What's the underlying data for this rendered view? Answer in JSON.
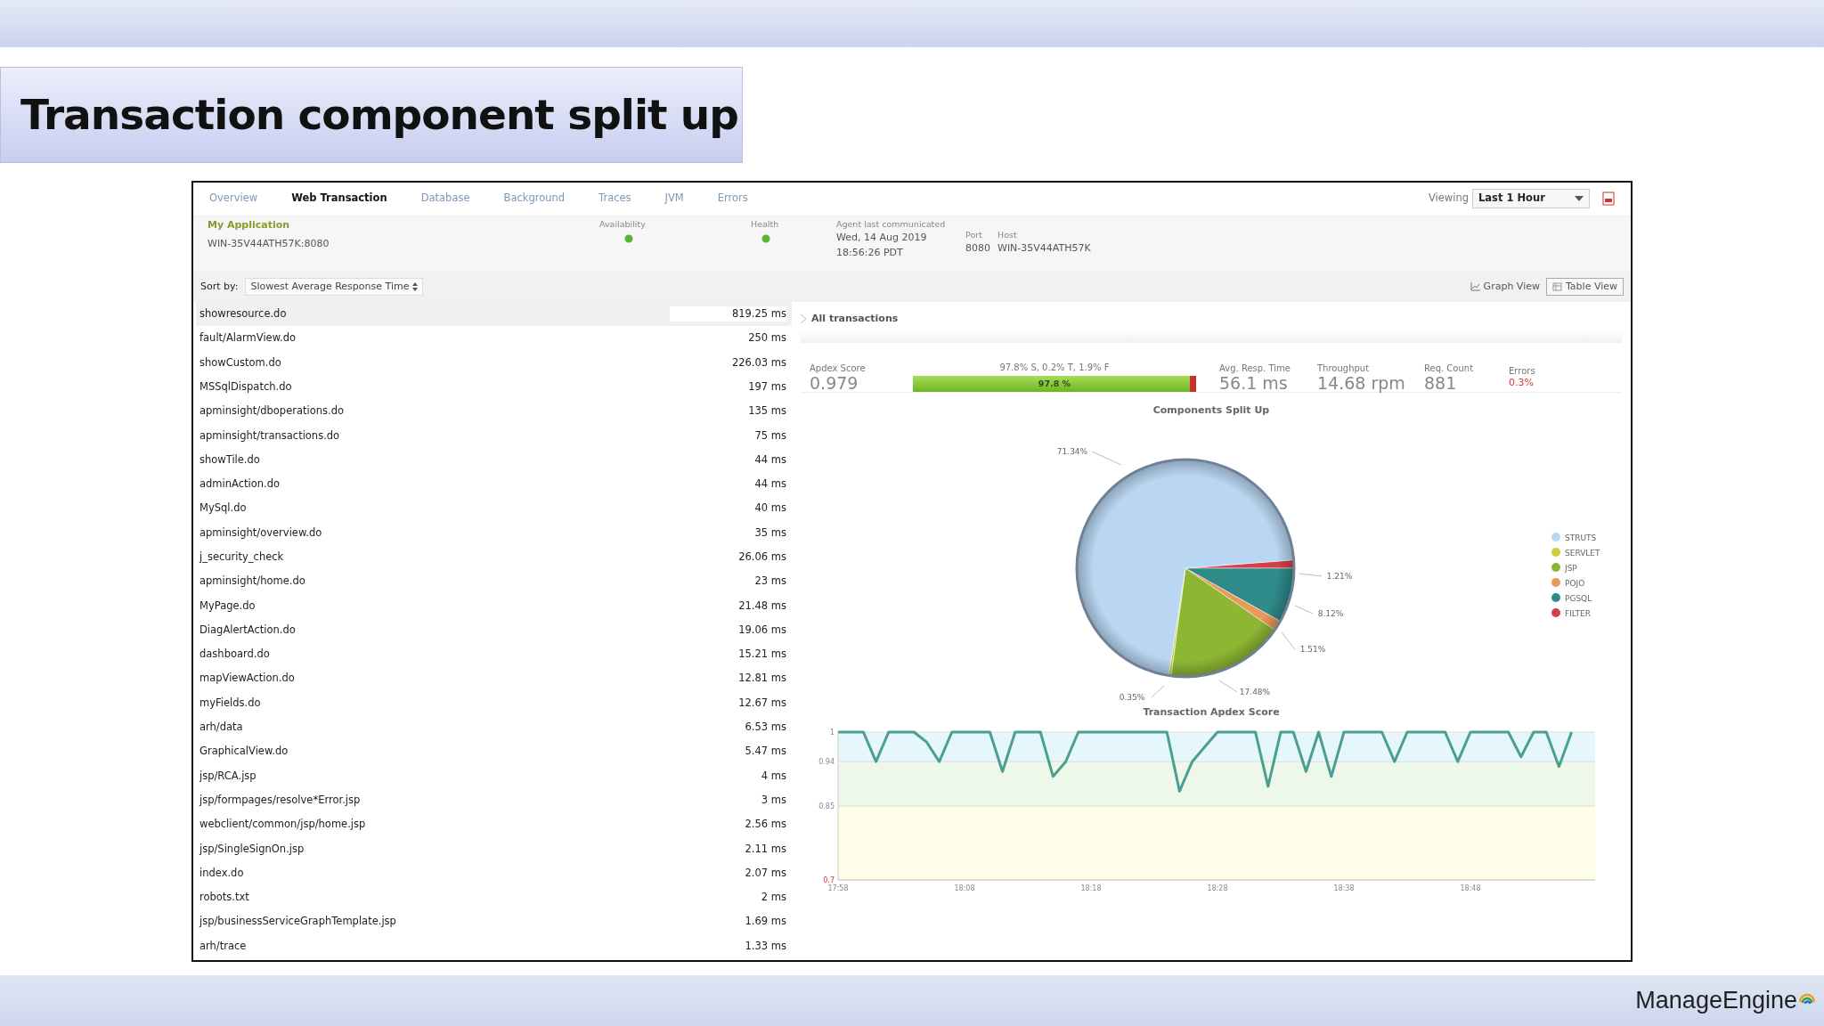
{
  "slide": {
    "title": "Transaction component split up",
    "logo": "ManageEngine"
  },
  "tabs": [
    {
      "label": "Overview",
      "selected": false
    },
    {
      "label": "Web Transaction",
      "selected": true
    },
    {
      "label": "Database",
      "selected": false
    },
    {
      "label": "Background",
      "selected": false
    },
    {
      "label": "Traces",
      "selected": false
    },
    {
      "label": "JVM",
      "selected": false
    },
    {
      "label": "Errors",
      "selected": false
    }
  ],
  "viewing": {
    "label": "Viewing",
    "value": "Last 1 Hour"
  },
  "info": {
    "name": "My Application",
    "address": "WIN-35V44ATH57K:8080",
    "availability": {
      "label": "Availability"
    },
    "health": {
      "label": "Health"
    },
    "agent": {
      "label": "Agent last communicated",
      "date": "Wed, 14 Aug 2019",
      "time": "18:56:26 PDT"
    },
    "port": {
      "label": "Port",
      "value": "8080"
    },
    "host": {
      "label": "Host",
      "value": "WIN-35V44ATH57K"
    }
  },
  "sort": {
    "label": "Sort by:",
    "value": "Slowest Average Response Time"
  },
  "views": [
    {
      "label": "Graph View",
      "kind": "graph",
      "selected": false
    },
    {
      "label": "Table View",
      "kind": "table",
      "selected": true
    }
  ],
  "transactions": [
    {
      "name": "showresource.do",
      "time": "819.25 ms",
      "selected": true
    },
    {
      "name": "fault/AlarmView.do",
      "time": "250 ms",
      "selected": false
    },
    {
      "name": "showCustom.do",
      "time": "226.03 ms",
      "selected": false
    },
    {
      "name": "MSSqlDispatch.do",
      "time": "197 ms",
      "selected": false
    },
    {
      "name": "apminsight/dboperations.do",
      "time": "135 ms",
      "selected": false
    },
    {
      "name": "apminsight/transactions.do",
      "time": "75 ms",
      "selected": false
    },
    {
      "name": "showTile.do",
      "time": "44 ms",
      "selected": false
    },
    {
      "name": "adminAction.do",
      "time": "44 ms",
      "selected": false
    },
    {
      "name": "MySql.do",
      "time": "40 ms",
      "selected": false
    },
    {
      "name": "apminsight/overview.do",
      "time": "35 ms",
      "selected": false
    },
    {
      "name": "j_security_check",
      "time": "26.06 ms",
      "selected": false
    },
    {
      "name": "apminsight/home.do",
      "time": "23 ms",
      "selected": false
    },
    {
      "name": "MyPage.do",
      "time": "21.48 ms",
      "selected": false
    },
    {
      "name": "DiagAlertAction.do",
      "time": "19.06 ms",
      "selected": false
    },
    {
      "name": "dashboard.do",
      "time": "15.21 ms",
      "selected": false
    },
    {
      "name": "mapViewAction.do",
      "time": "12.81 ms",
      "selected": false
    },
    {
      "name": "myFields.do",
      "time": "12.67 ms",
      "selected": false
    },
    {
      "name": "arh/data",
      "time": "6.53 ms",
      "selected": false
    },
    {
      "name": "GraphicalView.do",
      "time": "5.47 ms",
      "selected": false
    },
    {
      "name": "jsp/RCA.jsp",
      "time": "4 ms",
      "selected": false
    },
    {
      "name": "jsp/formpages/resolve*Error.jsp",
      "time": "3 ms",
      "selected": false
    },
    {
      "name": "webclient/common/jsp/home.jsp",
      "time": "2.56 ms",
      "selected": false
    },
    {
      "name": "jsp/SingleSignOn.jsp",
      "time": "2.11 ms",
      "selected": false
    },
    {
      "name": "index.do",
      "time": "2.07 ms",
      "selected": false
    },
    {
      "name": "robots.txt",
      "time": "2 ms",
      "selected": false
    },
    {
      "name": "jsp/businessServiceGraphTemplate.jsp",
      "time": "1.69 ms",
      "selected": false
    },
    {
      "name": "arh/trace",
      "time": "1.33 ms",
      "selected": false
    }
  ],
  "panel": {
    "title": "All transactions",
    "apdex": {
      "label": "Apdex Score",
      "value": "0.979",
      "breakdown": "97.8% S, 0.2% T, 1.9% F",
      "bar_label": "97.8 %",
      "level": 0.978
    },
    "metrics": [
      {
        "label": "Avg. Resp. Time",
        "value": "56.1 ms",
        "kind": "plain"
      },
      {
        "label": "Throughput",
        "value": "14.68 rpm",
        "kind": "plain"
      },
      {
        "label": "Req. Count",
        "value": "881",
        "kind": "plain"
      },
      {
        "label": "Errors",
        "value": "0.3%",
        "kind": "error"
      }
    ],
    "components": {
      "chart_data": {
        "type": "pie",
        "title": "Components Split Up",
        "categories": [
          "STRUTS",
          "SERVLET",
          "JSP",
          "POJO",
          "PGSQL",
          "FILTER"
        ],
        "series": [
          {
            "values": [
              71.34,
              0.35,
              17.48,
              1.51,
              8.12,
              1.21
            ]
          }
        ],
        "legend": "right",
        "colors": [
          "#b9d7f2",
          "#c8cf3a",
          "#8db733",
          "#e89a5a",
          "#2f8a8a",
          "#d2414b"
        ],
        "value_labels": [
          "71.34%",
          "0.35%",
          "17.48%",
          "1.51%",
          "8.12%",
          "1.21%"
        ]
      }
    },
    "apdex_trend": {
      "chart_data": {
        "type": "line",
        "title": "Transaction Apdex Score",
        "categories": [
          "17:58",
          null,
          null,
          null,
          null,
          null,
          null,
          null,
          null,
          null,
          "18:08",
          null,
          null,
          null,
          null,
          null,
          null,
          null,
          null,
          null,
          "18:18",
          null,
          null,
          null,
          null,
          null,
          null,
          null,
          null,
          null,
          "18:28",
          null,
          null,
          null,
          null,
          null,
          null,
          null,
          null,
          null,
          "18:38",
          null,
          null,
          null,
          null,
          null,
          null,
          null,
          null,
          null,
          "18:48",
          null,
          null,
          null,
          null,
          null,
          null,
          null,
          null
        ],
        "series": [
          {
            "color": "#4a9e92",
            "values": [
              1,
              1,
              1,
              0.94,
              1,
              1,
              1,
              0.98,
              0.94,
              1,
              1,
              1,
              1,
              0.92,
              1,
              1,
              1,
              0.91,
              0.94,
              1,
              1,
              1,
              1,
              1,
              1,
              1,
              1,
              0.88,
              0.94,
              0.97,
              1,
              1,
              1,
              1,
              0.89,
              1,
              1,
              0.92,
              1,
              0.91,
              1,
              1,
              1,
              1,
              0.94,
              1,
              1,
              1,
              1,
              0.94,
              1,
              1,
              1,
              1,
              0.95,
              1,
              1,
              0.93,
              1
            ]
          }
        ],
        "ylim": [
          0.7,
          1
        ],
        "yticks": [
          0.7,
          0.85,
          0.94,
          1
        ]
      }
    }
  }
}
